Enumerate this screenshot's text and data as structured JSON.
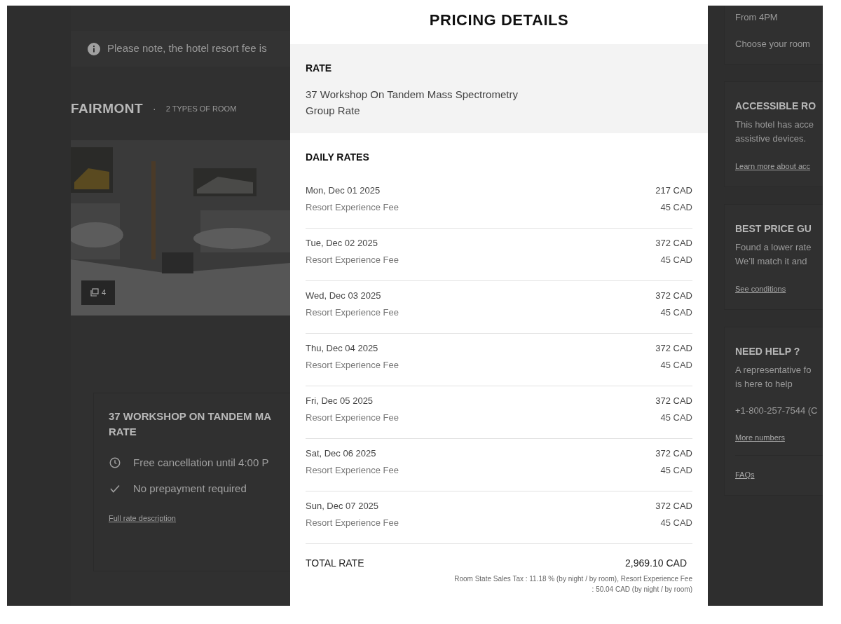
{
  "notice": {
    "text": "Please note, the hotel resort fee is"
  },
  "hotel": {
    "name": "FAIRMONT",
    "separator": "·",
    "room_types": "2 TYPES OF ROOM",
    "photo": {
      "kind": "picture",
      "count": "4"
    }
  },
  "rate_card": {
    "title_lines": [
      "37 WORKSHOP ON TANDEM MA",
      "RATE"
    ],
    "features": [
      {
        "kind": "clock",
        "text": "Free cancellation until 4:00 P"
      },
      {
        "kind": "check",
        "text": "No prepayment required"
      }
    ],
    "link": "Full rate description"
  },
  "sidebar": [
    {
      "lines": [
        "From 4PM"
      ],
      "extra": "Choose your room"
    },
    {
      "title": "ACCESSIBLE RO",
      "lines": [
        "This hotel has acce",
        "assistive devices."
      ],
      "links": [
        "Learn more about acc"
      ]
    },
    {
      "title": "BEST PRICE GU",
      "lines": [
        "Found a lower rate",
        "We’ll match it and"
      ],
      "links": [
        "See conditions"
      ]
    },
    {
      "title": "NEED HELP ?",
      "lines": [
        "A representative fo",
        "is here to help"
      ],
      "extra": "+1-800-257-7544 (C",
      "links": [
        "More numbers",
        "FAQs"
      ]
    }
  ],
  "modal": {
    "title": "PRICING DETAILS",
    "rate": {
      "heading": "RATE",
      "description_lines": [
        "37 Workshop On Tandem Mass Spectrometry",
        "Group Rate"
      ]
    },
    "daily_heading": "DAILY RATES",
    "daily_rates": [
      {
        "date": "Mon, Dec 01 2025",
        "price": "217 CAD",
        "fee_label": "Resort Experience Fee",
        "fee": "45 CAD"
      },
      {
        "date": "Tue, Dec 02 2025",
        "price": "372 CAD",
        "fee_label": "Resort Experience Fee",
        "fee": "45 CAD"
      },
      {
        "date": "Wed, Dec 03 2025",
        "price": "372 CAD",
        "fee_label": "Resort Experience Fee",
        "fee": "45 CAD"
      },
      {
        "date": "Thu, Dec 04 2025",
        "price": "372 CAD",
        "fee_label": "Resort Experience Fee",
        "fee": "45 CAD"
      },
      {
        "date": "Fri, Dec 05 2025",
        "price": "372 CAD",
        "fee_label": "Resort Experience Fee",
        "fee": "45 CAD"
      },
      {
        "date": "Sat, Dec 06 2025",
        "price": "372 CAD",
        "fee_label": "Resort Experience Fee",
        "fee": "45 CAD"
      },
      {
        "date": "Sun, Dec 07 2025",
        "price": "372 CAD",
        "fee_label": "Resort Experience Fee",
        "fee": "45 CAD"
      }
    ],
    "total": {
      "label": "TOTAL RATE",
      "value": "2,969.10 CAD",
      "notes": [
        "Room State Sales Tax : 11.18 % (by night / by room), Resort Experience Fee",
        ": 50.04 CAD (by night / by room)"
      ]
    }
  }
}
